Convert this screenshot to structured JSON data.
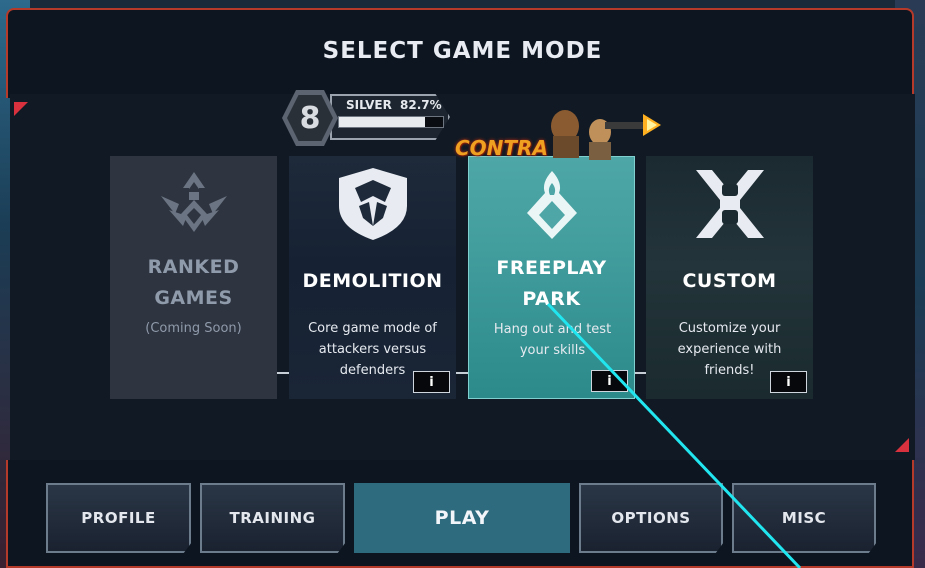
{
  "header": {
    "title": "SELECT GAME MODE"
  },
  "rank": {
    "emblem": "8",
    "tier": "SILVER",
    "progress_text": "82.7%",
    "progress": 0.827
  },
  "promo": {
    "logo_text": "CONTRA"
  },
  "modes": [
    {
      "title_line1": "RANKED",
      "title_line2": "GAMES",
      "desc": "(Coming Soon)",
      "icon": "ranked-emblem-icon",
      "enabled": false
    },
    {
      "title": "DEMOLITION",
      "desc_line1": "Core game mode of",
      "desc_line2": "attackers versus",
      "desc_line3": "defenders",
      "icon": "shield-icon",
      "info": "i"
    },
    {
      "title_line1": "FREEPLAY",
      "title_line2": "PARK",
      "desc_line1": "Hang out and test",
      "desc_line2": "your skills",
      "icon": "flame-diamond-icon",
      "info": "i"
    },
    {
      "title": "CUSTOM",
      "desc_line1": "Customize your",
      "desc_line2": "experience with",
      "desc_line3": "friends!",
      "icon": "x8-logo-icon",
      "info": "i"
    }
  ],
  "nav": {
    "profile": "PROFILE",
    "training": "TRAINING",
    "play": "PLAY",
    "options": "OPTIONS",
    "misc": "MISC"
  },
  "colors": {
    "accent_red": "#d9313d",
    "frame_red": "#b53a2a",
    "active_teal": "#2f6b7e",
    "laser": "#21e6f0"
  }
}
